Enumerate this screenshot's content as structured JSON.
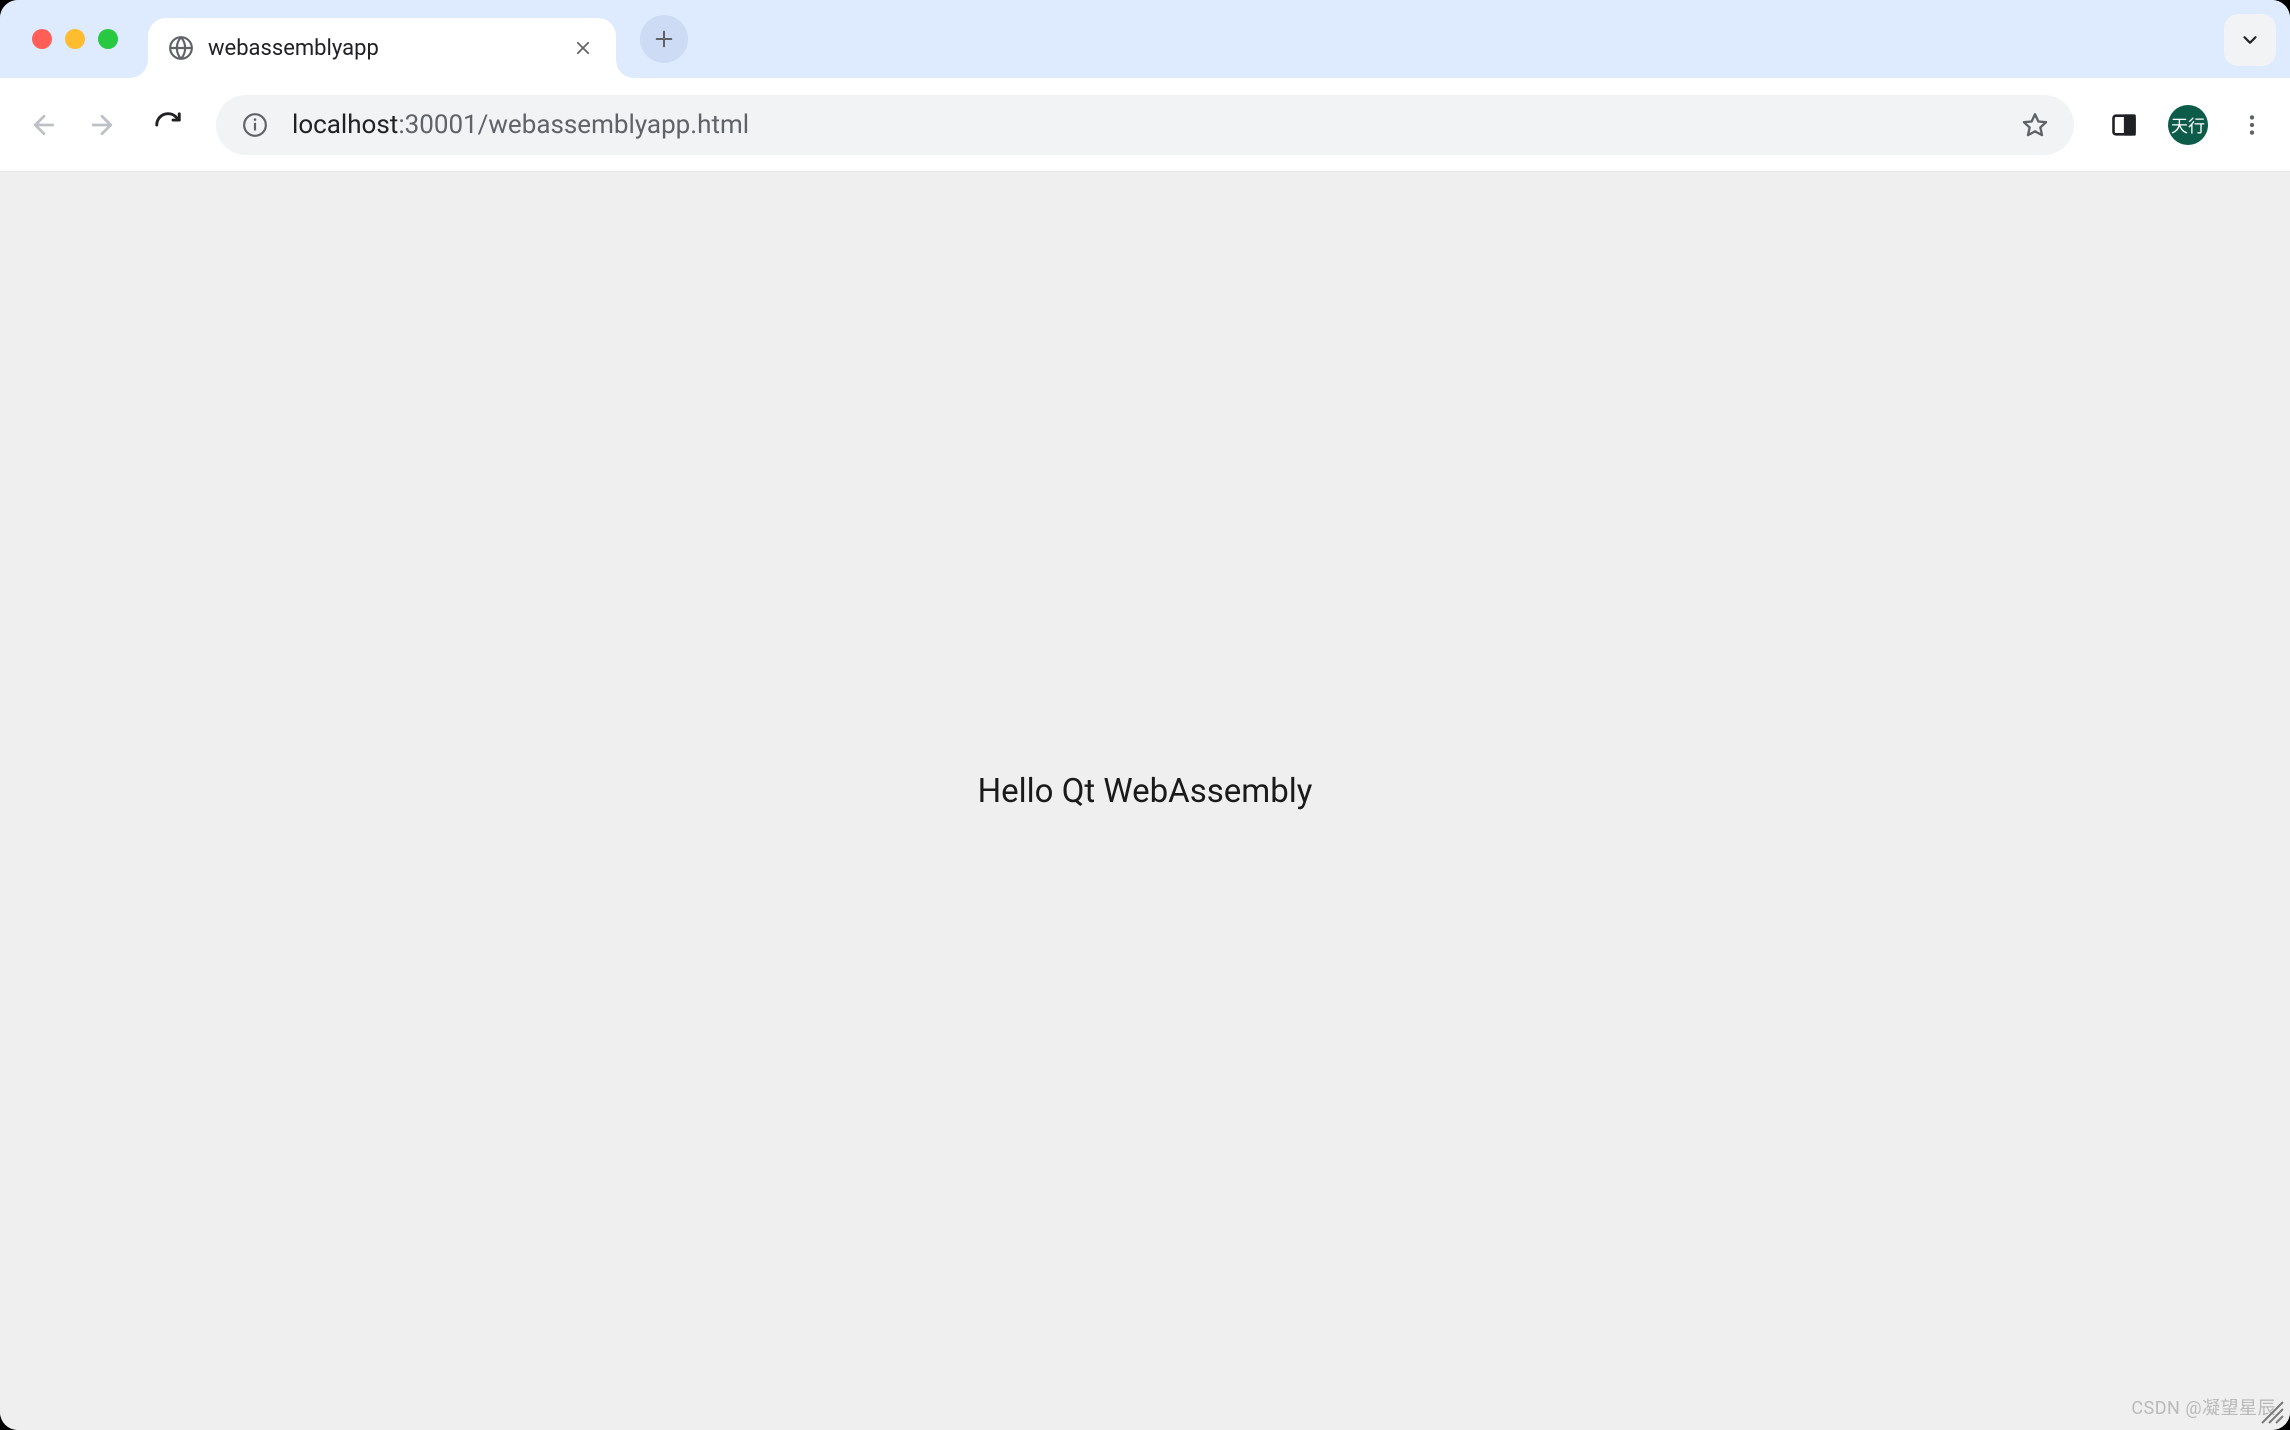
{
  "window": {
    "traffic_lights": {
      "close": "close",
      "minimize": "minimize",
      "maximize": "maximize"
    }
  },
  "tabs": {
    "active": {
      "title": "webassemblyapp",
      "favicon": "globe-icon"
    }
  },
  "toolbar": {
    "back_label": "Back",
    "forward_label": "Forward",
    "reload_label": "Reload"
  },
  "omnibox": {
    "host": "localhost",
    "port_path": ":30001/webassemblyapp.html"
  },
  "profile": {
    "avatar_label": "天行"
  },
  "content": {
    "text": "Hello Qt WebAssembly"
  },
  "watermark": "CSDN @凝望星辰"
}
